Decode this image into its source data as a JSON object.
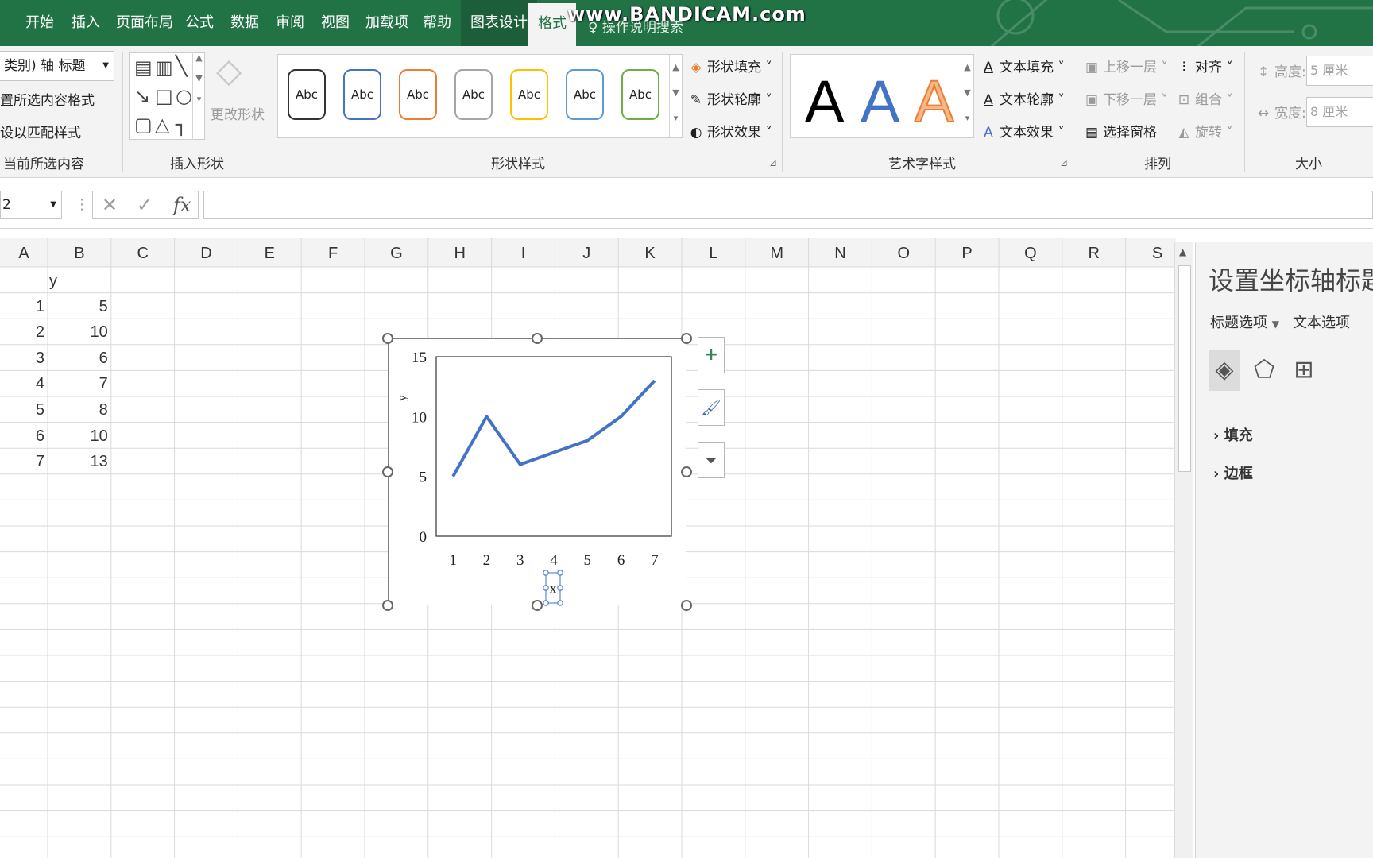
{
  "ribbon_tabs": {
    "home": "开始",
    "insert": "插入",
    "page_layout": "页面布局",
    "formulas": "公式",
    "data": "数据",
    "review": "审阅",
    "view": "视图",
    "addins": "加载项",
    "help": "帮助",
    "chart_design": "图表设计",
    "format": "格式",
    "tell_me": "操作说明搜索"
  },
  "watermark": "www.BANDICAM.com",
  "current_selection": {
    "dropdown_value": "类别) 轴 标题",
    "format_selection": "置所选内容格式",
    "reset_match": "设以匹配样式",
    "group_label": "当前所选内容"
  },
  "insert_shapes": {
    "change_shape": "更改形状",
    "group_label": "插入形状"
  },
  "shape_styles": {
    "samples": [
      "Abc",
      "Abc",
      "Abc",
      "Abc",
      "Abc",
      "Abc",
      "Abc"
    ],
    "sample_colors": [
      "#333333",
      "#4472c4",
      "#ed7d31",
      "#a5a5a5",
      "#ffc000",
      "#5b9bd5",
      "#70ad47"
    ],
    "fill": "形状填充",
    "outline": "形状轮廓",
    "effects": "形状效果",
    "group_label": "形状样式"
  },
  "wordart": {
    "letters": [
      "A",
      "A",
      "A"
    ],
    "colors": [
      "#000000",
      "#4472c4",
      "#ed7d31"
    ],
    "text_fill": "文本填充",
    "text_outline": "文本轮廓",
    "text_effects": "文本效果",
    "group_label": "艺术字样式"
  },
  "arrange": {
    "bring_forward": "上移一层",
    "send_backward": "下移一层",
    "selection_pane": "选择窗格",
    "align": "对齐",
    "group": "组合",
    "rotate": "旋转",
    "group_label": "排列"
  },
  "size": {
    "height_label": "高度:",
    "height_value": "5 厘米",
    "width_label": "宽度:",
    "width_value": "8 厘米",
    "group_label": "大小"
  },
  "formula_bar": {
    "name_box": "2",
    "fx": "fx",
    "content": ""
  },
  "columns": [
    "A",
    "B",
    "C",
    "D",
    "E",
    "F",
    "G",
    "H",
    "I",
    "J",
    "K",
    "L",
    "M",
    "N",
    "O",
    "P",
    "Q",
    "R",
    "S"
  ],
  "sheet": {
    "b1": "y",
    "rows": [
      {
        "a": "1",
        "b": "5"
      },
      {
        "a": "2",
        "b": "10"
      },
      {
        "a": "3",
        "b": "6"
      },
      {
        "a": "4",
        "b": "7"
      },
      {
        "a": "5",
        "b": "8"
      },
      {
        "a": "6",
        "b": "10"
      },
      {
        "a": "7",
        "b": "13"
      }
    ]
  },
  "chart_data": {
    "type": "line",
    "x": [
      "1",
      "2",
      "3",
      "4",
      "5",
      "6",
      "7"
    ],
    "series": [
      {
        "values": [
          5,
          10,
          6,
          7,
          8,
          10,
          13
        ],
        "color": "#4472c4"
      }
    ],
    "ylim": [
      0,
      15
    ],
    "yticks": [
      "0",
      "5",
      "10",
      "15"
    ],
    "xlabel": "x",
    "ylabel": "y",
    "title": "",
    "grid": false
  },
  "task_pane": {
    "title": "设置坐标轴标题格",
    "tab_title_options": "标题选项",
    "tab_text_options": "文本选项",
    "section_fill": "填充",
    "section_border": "边框"
  }
}
